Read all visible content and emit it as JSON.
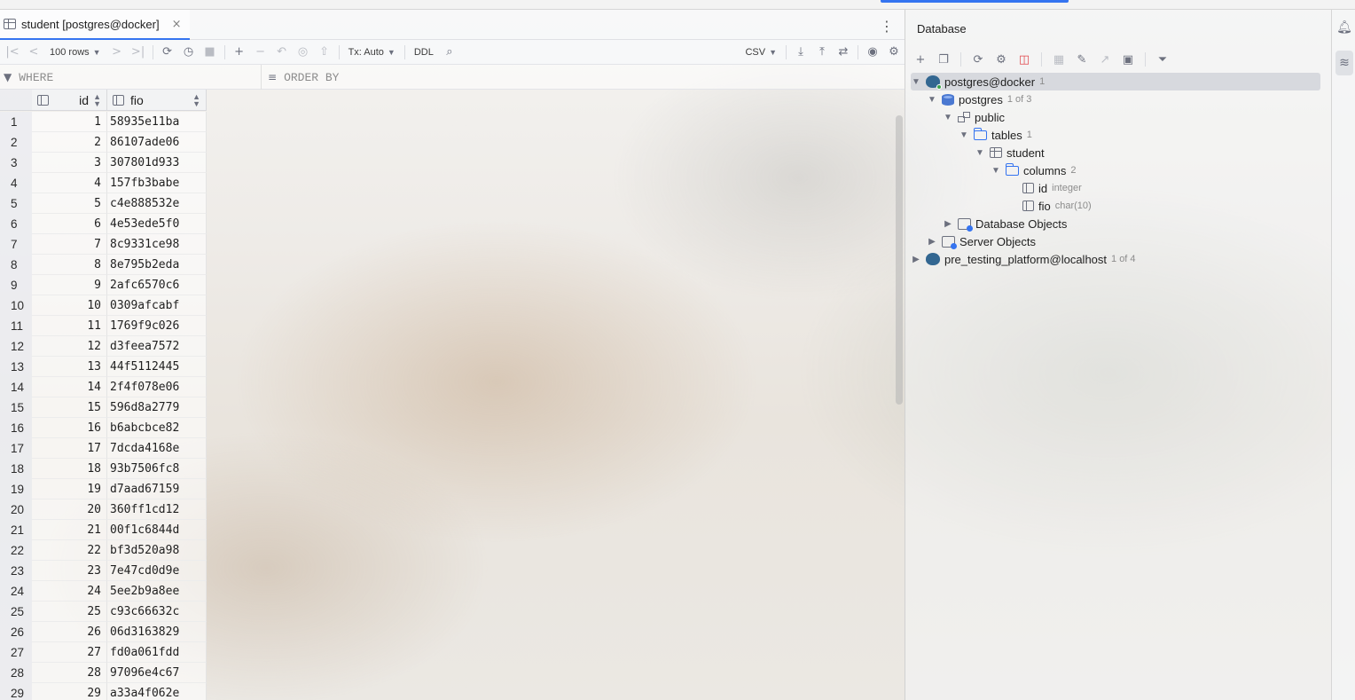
{
  "editor": {
    "tab": {
      "title": "student [postgres@docker]",
      "close": "×"
    },
    "toolbar": {
      "page_size": "100 rows",
      "tx_mode": "Tx: Auto",
      "ddl": "DDL",
      "export_format": "CSV"
    },
    "filter": {
      "where_placeholder": "WHERE",
      "order_placeholder": "ORDER BY"
    },
    "grid": {
      "columns": [
        {
          "name": "id"
        },
        {
          "name": "fio"
        }
      ],
      "rows": [
        {
          "n": "1",
          "id": "1",
          "fio": "58935e11ba"
        },
        {
          "n": "2",
          "id": "2",
          "fio": "86107ade06"
        },
        {
          "n": "3",
          "id": "3",
          "fio": "307801d933"
        },
        {
          "n": "4",
          "id": "4",
          "fio": "157fb3babe"
        },
        {
          "n": "5",
          "id": "5",
          "fio": "c4e888532e"
        },
        {
          "n": "6",
          "id": "6",
          "fio": "4e53ede5f0"
        },
        {
          "n": "7",
          "id": "7",
          "fio": "8c9331ce98"
        },
        {
          "n": "8",
          "id": "8",
          "fio": "8e795b2eda"
        },
        {
          "n": "9",
          "id": "9",
          "fio": "2afc6570c6"
        },
        {
          "n": "10",
          "id": "10",
          "fio": "0309afcabf"
        },
        {
          "n": "11",
          "id": "11",
          "fio": "1769f9c026"
        },
        {
          "n": "12",
          "id": "12",
          "fio": "d3feea7572"
        },
        {
          "n": "13",
          "id": "13",
          "fio": "44f5112445"
        },
        {
          "n": "14",
          "id": "14",
          "fio": "2f4f078e06"
        },
        {
          "n": "15",
          "id": "15",
          "fio": "596d8a2779"
        },
        {
          "n": "16",
          "id": "16",
          "fio": "b6abcbce82"
        },
        {
          "n": "17",
          "id": "17",
          "fio": "7dcda4168e"
        },
        {
          "n": "18",
          "id": "18",
          "fio": "93b7506fc8"
        },
        {
          "n": "19",
          "id": "19",
          "fio": "d7aad67159"
        },
        {
          "n": "20",
          "id": "20",
          "fio": "360ff1cd12"
        },
        {
          "n": "21",
          "id": "21",
          "fio": "00f1c6844d"
        },
        {
          "n": "22",
          "id": "22",
          "fio": "bf3d520a98"
        },
        {
          "n": "23",
          "id": "23",
          "fio": "7e47cd0d9e"
        },
        {
          "n": "24",
          "id": "24",
          "fio": "5ee2b9a8ee"
        },
        {
          "n": "25",
          "id": "25",
          "fio": "c93c66632c"
        },
        {
          "n": "26",
          "id": "26",
          "fio": "06d3163829"
        },
        {
          "n": "27",
          "id": "27",
          "fio": "fd0a061fdd"
        },
        {
          "n": "28",
          "id": "28",
          "fio": "97096e4c67"
        },
        {
          "n": "29",
          "id": "29",
          "fio": "a33a4f062e"
        }
      ]
    }
  },
  "database": {
    "title": "Database",
    "tree": {
      "connection": {
        "label": "postgres@docker",
        "count": "1"
      },
      "db": {
        "label": "postgres",
        "count": "1 of 3"
      },
      "schema": {
        "label": "public"
      },
      "tables": {
        "label": "tables",
        "count": "1"
      },
      "table": {
        "label": "student"
      },
      "columns": {
        "label": "columns",
        "count": "2"
      },
      "col_id": {
        "label": "id",
        "type": "integer"
      },
      "col_fio": {
        "label": "fio",
        "type": "char(10)"
      },
      "db_objects": {
        "label": "Database Objects"
      },
      "server_objects": {
        "label": "Server Objects"
      },
      "connection2": {
        "label": "pre_testing_platform@localhost",
        "count": "1 of 4"
      }
    }
  },
  "colors": {
    "accent": "#3574f0",
    "postgres": "#336791"
  }
}
